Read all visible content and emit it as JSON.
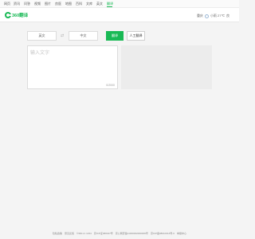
{
  "topnav": {
    "items": [
      "网页",
      "资讯",
      "问答",
      "视频",
      "图片",
      "良医",
      "地图",
      "百科",
      "文库",
      "英文",
      "翻译"
    ],
    "active_index": 10
  },
  "header": {
    "logo_text": "360翻译",
    "weather": {
      "city": "重庆",
      "temp": "小雨 27℃",
      "aqi": "良"
    }
  },
  "controls": {
    "source_lang": "英文",
    "target_lang": "中文",
    "swap_icon": "⇄",
    "translate_label": "翻译",
    "human_label": "人工翻译"
  },
  "input": {
    "placeholder": "输入文字",
    "value": "",
    "char_count": "0/2000"
  },
  "footer": {
    "items": [
      "隐私政策",
      "意见反馈",
      "©360.cn 1234",
      "京ICP证080047号",
      "京公网安备11000002000006号",
      "京ICP备08010314号-6",
      "举报中心"
    ]
  },
  "colors": {
    "accent": "#19b955",
    "output_bg": "#ececec"
  }
}
